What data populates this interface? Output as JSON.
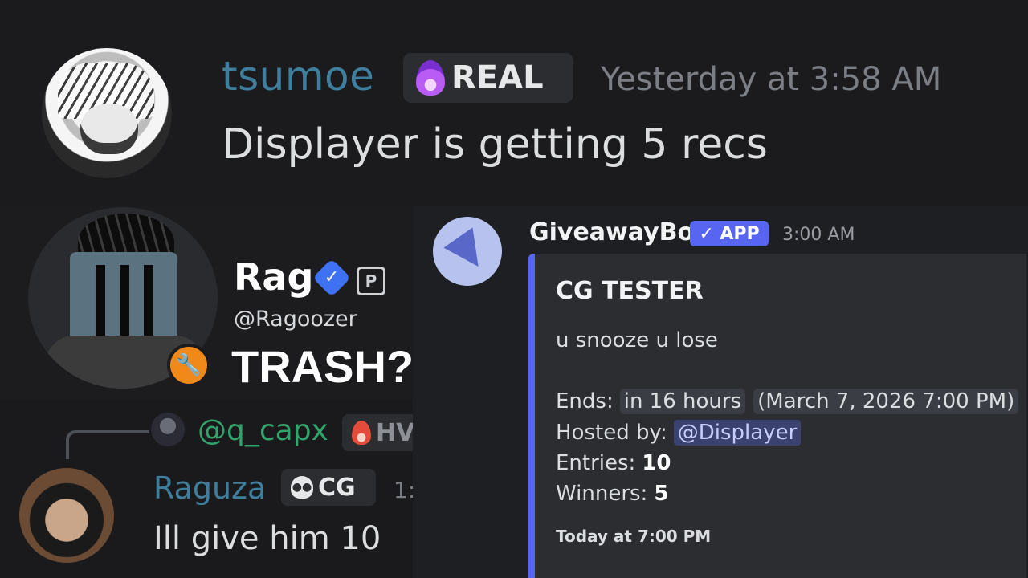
{
  "top_message": {
    "username": "tsumoe",
    "role_tag": "REAL",
    "timestamp": "Yesterday at 3:58 AM",
    "content": "Displayer is getting 5 recs"
  },
  "profile_card": {
    "display_name": "Rag",
    "handle": "@Ragoozer",
    "overlay_text": "TRASH?"
  },
  "reply_message": {
    "replied_user": "@q_capx",
    "replied_tag": "HV",
    "username": "Raguza",
    "role_tag": "CG",
    "timestamp": "1:",
    "content": "Ill give him 10"
  },
  "bot_message": {
    "bot_name": "GiveawayBot",
    "app_tag": "✓ APP",
    "timestamp": "3:00 AM",
    "embed": {
      "title": "CG TESTER",
      "description": "u snooze u lose",
      "ends_label": "Ends:",
      "ends_relative": "in 16 hours",
      "ends_absolute": "(March 7, 2026 7:00 PM)",
      "hosted_label": "Hosted by:",
      "host_mention": "@Displayer",
      "entries_label": "Entries:",
      "entries_value": "10",
      "winners_label": "Winners:",
      "winners_value": "5",
      "footer": "Today at 7:00 PM"
    }
  },
  "colors": {
    "accent": "#5865f2",
    "username_blue": "#3f7e9d",
    "reply_green": "#32a36b",
    "badge_orange": "#f0881a"
  }
}
